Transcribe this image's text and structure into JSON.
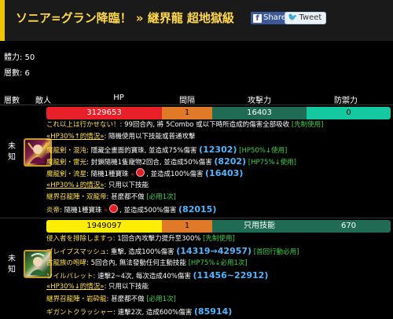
{
  "title": "ソニア=グラン降臨！ » 継界龍 超地獄級",
  "share": {
    "facebook_label": "Share",
    "twitter_label": "Tweet"
  },
  "stamina": "體力: 50",
  "floors": "層數: 6",
  "table_headers": {
    "floor": "層數",
    "enemy": "敵人",
    "hp": "HP",
    "turn": "間隔",
    "atk": "攻擊力",
    "def": "防禦力"
  },
  "enemy1": {
    "floor": "未\n知",
    "hp": "3129653",
    "turn": "1",
    "atk": "16403",
    "def": "0",
    "lines": [
      {
        "parts": [
          [
            "これ以上は行かせない！",
            "y"
          ],
          [
            ": 99回合內, 將 5Combo 或以下時所造成的傷害全部吸收 ",
            "w"
          ],
          [
            "[先制使用]",
            "g"
          ]
        ]
      },
      {
        "parts": [
          [
            "«HP30%↑的情況»",
            "y und"
          ],
          [
            ": 隨機使用以下技能或普通攻擊",
            "w"
          ]
        ]
      },
      {
        "parts": [
          [
            "魔龍剣・混沌",
            "y"
          ],
          [
            ": 隱藏全畫面的寶珠, 並造成75%傷害 ",
            "w"
          ],
          [
            "(12302)",
            "big"
          ],
          [
            " [HP50%↓使用]",
            "g"
          ]
        ]
      },
      {
        "parts": [
          [
            "魔龍剣・雷光",
            "y"
          ],
          [
            ": 封鎖隨機1隻寵物2回合, 並造成50%傷害 ",
            "w"
          ],
          [
            "(8202)",
            "big"
          ],
          [
            " [HP75%↓使用]",
            "g"
          ]
        ]
      },
      {
        "parts": [
          [
            "魔龍剣・流星",
            "y"
          ],
          [
            ": 隨機1種寶珠 ",
            "w"
          ],
          [
            "»",
            "arrow"
          ],
          [
            "●",
            "dot"
          ],
          [
            ", 並造成100%傷害 ",
            "w"
          ],
          [
            "(16403)",
            "big"
          ]
        ]
      },
      {
        "parts": [
          [
            "«HP30%↓的情況»",
            "y und"
          ],
          [
            ": 只用以下技能",
            "w"
          ]
        ]
      },
      {
        "parts": [
          [
            "継界召龍陣・双龍帝",
            "y"
          ],
          [
            ": 甚麼都不做 ",
            "w"
          ],
          [
            "[必用1次]",
            "g"
          ]
        ]
      },
      {
        "parts": [
          [
            "炎帝",
            "y"
          ],
          [
            ": 隨機1種寶珠 ",
            "w"
          ],
          [
            "»",
            "arrow"
          ],
          [
            "●",
            "dot"
          ],
          [
            ", 並造成500%傷害 ",
            "w"
          ],
          [
            "(82015)",
            "big"
          ]
        ]
      }
    ]
  },
  "enemy2": {
    "floor": "未\n知",
    "hp": "1949097",
    "turn": "1",
    "atk": "只用技能",
    "def": "670",
    "lines": [
      {
        "parts": [
          [
            "侵入者を排除しますっ",
            "y"
          ],
          [
            ": 1回合內攻擊力提升至300% ",
            "w"
          ],
          [
            "[先制使用]",
            "g"
          ]
        ]
      },
      {
        "parts": [
          [
            "ブレイブスマッシュ",
            "y"
          ],
          [
            ": 重擊, 造成100%傷害 ",
            "w"
          ],
          [
            "(14319→42957)",
            "big"
          ],
          [
            " [首回行動必用]",
            "g"
          ]
        ]
      },
      {
        "parts": [
          [
            "古龍族の咆哮",
            "y"
          ],
          [
            ": 5回合內, 無法發動任何主動技能 ",
            "w"
          ],
          [
            "[HP75%↓必用1次]",
            "g"
          ]
        ]
      },
      {
        "parts": [
          [
            "ソイルバレット",
            "y"
          ],
          [
            ": 連擊2~4次, 每次造成40%傷害 ",
            "w"
          ],
          [
            "(11456~22912)",
            "big"
          ]
        ]
      },
      {
        "parts": [
          [
            "«HP30%↓的情況»",
            "y und"
          ],
          [
            ": 只用以下技能",
            "w"
          ]
        ]
      },
      {
        "parts": [
          [
            "継界召龍陣・岩砕龍",
            "y"
          ],
          [
            ": 甚麼都不做 ",
            "w"
          ],
          [
            "[必用1次]",
            "g"
          ]
        ]
      },
      {
        "parts": [
          [
            "ギガントクラッシャー",
            "y"
          ],
          [
            ": 連擊2次, 造成600%傷害 ",
            "w"
          ],
          [
            "(85914)",
            "big"
          ]
        ]
      }
    ]
  },
  "colors": {
    "hp_red": "#e8202a",
    "hp_yellow": "#ffee00",
    "turn_orange": "#e07a28",
    "atk_green": "#1f6b54",
    "def_teal": "#14c9a0",
    "accent_gold": "#f0c400"
  }
}
